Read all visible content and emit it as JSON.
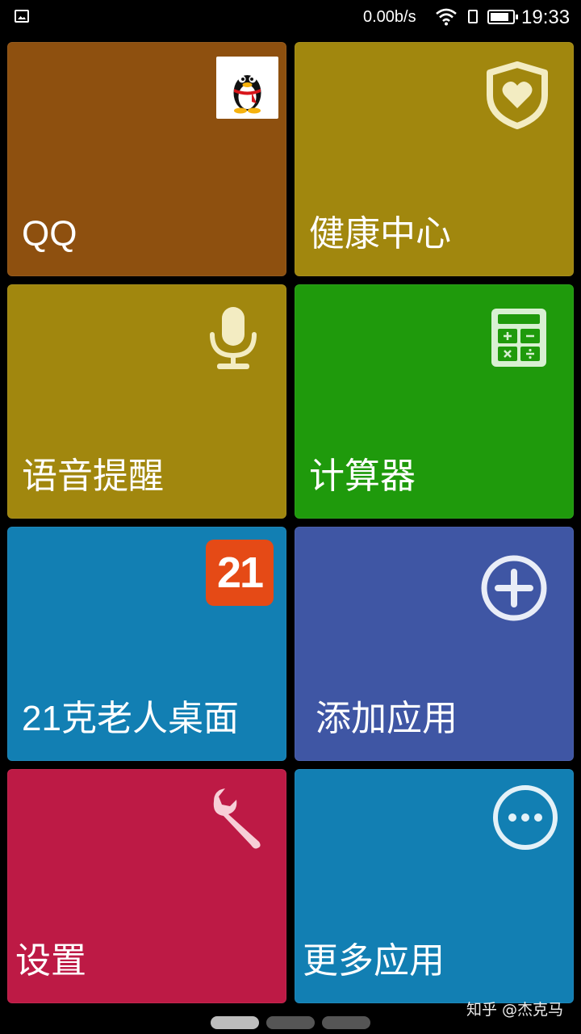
{
  "status_bar": {
    "network_speed": "0.00b/s",
    "time": "19:33",
    "battery_level": 0.85
  },
  "tiles": [
    {
      "label": "QQ",
      "icon": "qq-penguin-icon",
      "color": "#8e500f"
    },
    {
      "label": "健康中心",
      "icon": "heart-shield-icon",
      "color": "#a1870e"
    },
    {
      "label": "语音提醒",
      "icon": "microphone-icon",
      "color": "#a1870e"
    },
    {
      "label": "计算器",
      "icon": "calculator-icon",
      "color": "#1f9a0c"
    },
    {
      "label": "21克老人桌面",
      "icon": "badge-21-icon",
      "badge_text": "21",
      "color": "#127fb3"
    },
    {
      "label": "添加应用",
      "icon": "plus-circle-icon",
      "color": "#3f56a4"
    },
    {
      "label": "设置",
      "icon": "wrench-icon",
      "color": "#bd1a45"
    },
    {
      "label": "更多应用",
      "icon": "more-dots-icon",
      "color": "#127fb3"
    }
  ],
  "pager": {
    "pages": 3,
    "active": 0
  },
  "watermark": "知乎 @杰克马"
}
